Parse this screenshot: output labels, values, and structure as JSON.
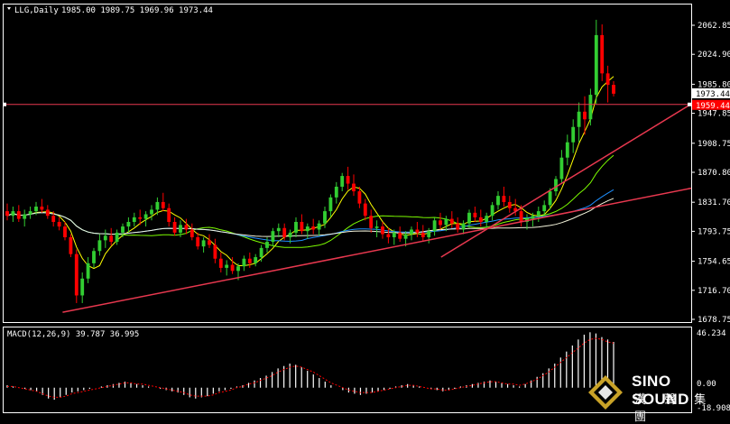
{
  "header": {
    "symbol": "LLG,Daily",
    "ohlc": "1985.00 1989.75 1969.96 1973.44",
    "triangle_color": "#ffffff"
  },
  "macd": {
    "label": "MACD(12,26,9) 39.787 36.995",
    "axis_top": "46.234",
    "axis_bottom": "-18.908",
    "axis_mid": "0.00"
  },
  "watermark": {
    "brand_en": "SINO SOUND",
    "brand_cn": "漢 聲 集 團"
  },
  "colors": {
    "background": "#000000",
    "bull_candle": "#32cd32",
    "bear_candle": "#ff0000",
    "channel_line": "#e8384f",
    "horizontal_line": "#e8384f",
    "ma_fast": "#ffff00",
    "ma_mid": "#1e90ff",
    "ma_slow1": "#7cfc00",
    "ma_slow2": "#f5f5dc",
    "macd_hist": "#ffffff",
    "macd_signal": "#ff0000",
    "price_badge": "#ffffff",
    "level_badge": "#ff0000"
  },
  "chart_data": {
    "type": "candlestick",
    "title": "LLG,Daily",
    "y_axis_ticks": [
      "2062.85",
      "2024.90",
      "1985.80",
      "1947.85",
      "1908.75",
      "1870.80",
      "1831.70",
      "1793.75",
      "1754.65",
      "1716.70",
      "1678.75"
    ],
    "price_badge": "1973.44",
    "level_badge": "1959.44",
    "ylim": [
      1678.75,
      2080
    ],
    "horizontal_level": 1959.44,
    "channel_upper": [
      [
        1,
        1760
      ],
      [
        97,
        1870
      ],
      [
        163,
        1960
      ]
    ],
    "channel_lower": [
      [
        1,
        1688
      ],
      [
        97,
        1760
      ],
      [
        163,
        1850
      ]
    ],
    "ohlc": [
      [
        1820,
        1830,
        1808,
        1814
      ],
      [
        1814,
        1826,
        1806,
        1820
      ],
      [
        1820,
        1828,
        1806,
        1810
      ],
      [
        1810,
        1822,
        1800,
        1816
      ],
      [
        1816,
        1826,
        1810,
        1820
      ],
      [
        1820,
        1832,
        1815,
        1826
      ],
      [
        1826,
        1836,
        1818,
        1822
      ],
      [
        1822,
        1828,
        1810,
        1814
      ],
      [
        1814,
        1820,
        1800,
        1806
      ],
      [
        1806,
        1812,
        1795,
        1800
      ],
      [
        1800,
        1806,
        1782,
        1786
      ],
      [
        1786,
        1790,
        1760,
        1764
      ],
      [
        1764,
        1770,
        1700,
        1710
      ],
      [
        1710,
        1740,
        1700,
        1732
      ],
      [
        1732,
        1760,
        1726,
        1752
      ],
      [
        1752,
        1772,
        1746,
        1768
      ],
      [
        1768,
        1790,
        1762,
        1782
      ],
      [
        1782,
        1796,
        1772,
        1788
      ],
      [
        1788,
        1798,
        1775,
        1780
      ],
      [
        1780,
        1796,
        1776,
        1792
      ],
      [
        1792,
        1804,
        1786,
        1800
      ],
      [
        1800,
        1812,
        1792,
        1806
      ],
      [
        1806,
        1818,
        1800,
        1812
      ],
      [
        1812,
        1822,
        1802,
        1810
      ],
      [
        1810,
        1820,
        1800,
        1816
      ],
      [
        1816,
        1828,
        1808,
        1822
      ],
      [
        1822,
        1838,
        1815,
        1832
      ],
      [
        1832,
        1844,
        1820,
        1824
      ],
      [
        1824,
        1830,
        1800,
        1806
      ],
      [
        1806,
        1812,
        1788,
        1792
      ],
      [
        1792,
        1808,
        1786,
        1802
      ],
      [
        1802,
        1810,
        1790,
        1796
      ],
      [
        1796,
        1804,
        1782,
        1786
      ],
      [
        1786,
        1792,
        1770,
        1774
      ],
      [
        1774,
        1786,
        1766,
        1782
      ],
      [
        1782,
        1790,
        1772,
        1776
      ],
      [
        1776,
        1784,
        1752,
        1758
      ],
      [
        1758,
        1766,
        1740,
        1746
      ],
      [
        1746,
        1756,
        1736,
        1750
      ],
      [
        1750,
        1760,
        1738,
        1742
      ],
      [
        1742,
        1752,
        1730,
        1748
      ],
      [
        1748,
        1762,
        1742,
        1758
      ],
      [
        1758,
        1766,
        1746,
        1752
      ],
      [
        1752,
        1764,
        1748,
        1760
      ],
      [
        1760,
        1776,
        1754,
        1772
      ],
      [
        1772,
        1786,
        1766,
        1780
      ],
      [
        1780,
        1798,
        1774,
        1794
      ],
      [
        1794,
        1804,
        1786,
        1798
      ],
      [
        1798,
        1804,
        1782,
        1786
      ],
      [
        1786,
        1796,
        1778,
        1792
      ],
      [
        1792,
        1812,
        1786,
        1806
      ],
      [
        1806,
        1816,
        1790,
        1794
      ],
      [
        1794,
        1804,
        1784,
        1800
      ],
      [
        1800,
        1810,
        1790,
        1796
      ],
      [
        1796,
        1808,
        1788,
        1804
      ],
      [
        1804,
        1826,
        1798,
        1820
      ],
      [
        1820,
        1842,
        1812,
        1838
      ],
      [
        1838,
        1858,
        1830,
        1852
      ],
      [
        1852,
        1870,
        1846,
        1866
      ],
      [
        1866,
        1878,
        1848,
        1856
      ],
      [
        1856,
        1868,
        1840,
        1846
      ],
      [
        1846,
        1852,
        1824,
        1830
      ],
      [
        1830,
        1836,
        1808,
        1814
      ],
      [
        1814,
        1822,
        1792,
        1798
      ],
      [
        1798,
        1808,
        1786,
        1800
      ],
      [
        1800,
        1806,
        1784,
        1790
      ],
      [
        1790,
        1798,
        1778,
        1786
      ],
      [
        1786,
        1796,
        1776,
        1792
      ],
      [
        1792,
        1800,
        1780,
        1784
      ],
      [
        1784,
        1794,
        1774,
        1790
      ],
      [
        1790,
        1800,
        1782,
        1796
      ],
      [
        1796,
        1806,
        1786,
        1792
      ],
      [
        1792,
        1802,
        1780,
        1786
      ],
      [
        1786,
        1798,
        1778,
        1794
      ],
      [
        1794,
        1812,
        1788,
        1808
      ],
      [
        1808,
        1818,
        1796,
        1802
      ],
      [
        1802,
        1814,
        1794,
        1810
      ],
      [
        1810,
        1820,
        1798,
        1804
      ],
      [
        1804,
        1812,
        1792,
        1796
      ],
      [
        1796,
        1808,
        1790,
        1804
      ],
      [
        1804,
        1822,
        1798,
        1818
      ],
      [
        1818,
        1826,
        1806,
        1812
      ],
      [
        1812,
        1822,
        1800,
        1806
      ],
      [
        1806,
        1818,
        1798,
        1814
      ],
      [
        1814,
        1832,
        1808,
        1828
      ],
      [
        1828,
        1846,
        1822,
        1840
      ],
      [
        1840,
        1852,
        1826,
        1832
      ],
      [
        1832,
        1840,
        1818,
        1824
      ],
      [
        1824,
        1836,
        1814,
        1820
      ],
      [
        1820,
        1828,
        1800,
        1806
      ],
      [
        1806,
        1816,
        1796,
        1810
      ],
      [
        1810,
        1818,
        1800,
        1814
      ],
      [
        1814,
        1826,
        1806,
        1820
      ],
      [
        1820,
        1834,
        1812,
        1828
      ],
      [
        1828,
        1850,
        1822,
        1846
      ],
      [
        1846,
        1866,
        1840,
        1862
      ],
      [
        1862,
        1900,
        1856,
        1890
      ],
      [
        1890,
        1920,
        1880,
        1910
      ],
      [
        1910,
        1940,
        1896,
        1930
      ],
      [
        1930,
        1962,
        1910,
        1950
      ],
      [
        1950,
        1970,
        1920,
        1940
      ],
      [
        1940,
        1980,
        1932,
        1972
      ],
      [
        1972,
        2070,
        1960,
        2050
      ],
      [
        2050,
        2064,
        1990,
        2000
      ],
      [
        2000,
        2010,
        1962,
        1985
      ],
      [
        1985,
        1989.75,
        1969.96,
        1973.44
      ]
    ],
    "macd_hist": [
      2,
      1,
      0,
      -1,
      -2,
      -3,
      -6,
      -9,
      -10,
      -8,
      -6,
      -4,
      -3,
      -2,
      -1,
      0,
      1,
      2,
      3,
      4,
      5,
      4,
      3,
      2,
      1,
      0,
      -1,
      -2,
      -3,
      -4,
      -6,
      -8,
      -9,
      -8,
      -7,
      -5,
      -3,
      -2,
      -1,
      1,
      2,
      4,
      6,
      8,
      10,
      13,
      16,
      18,
      20,
      19,
      17,
      14,
      11,
      8,
      5,
      2,
      0,
      -2,
      -4,
      -5,
      -6,
      -5,
      -4,
      -3,
      -2,
      -1,
      1,
      2,
      3,
      2,
      1,
      0,
      -1,
      -2,
      -3,
      -2,
      -1,
      1,
      2,
      3,
      4,
      5,
      6,
      5,
      4,
      3,
      2,
      1,
      3,
      6,
      9,
      12,
      16,
      20,
      25,
      30,
      35,
      40,
      44,
      46,
      45,
      42,
      40,
      38
    ],
    "macd_signal": [
      1,
      1,
      0,
      -1,
      -2,
      -3,
      -5,
      -7,
      -8,
      -8,
      -7,
      -5,
      -4,
      -3,
      -2,
      -1,
      0,
      1,
      2,
      3,
      4,
      4,
      3,
      3,
      2,
      1,
      0,
      -1,
      -2,
      -3,
      -4,
      -6,
      -7,
      -7,
      -7,
      -6,
      -4,
      -3,
      -2,
      0,
      1,
      3,
      4,
      6,
      8,
      10,
      13,
      15,
      17,
      18,
      17,
      15,
      13,
      10,
      7,
      4,
      2,
      0,
      -2,
      -3,
      -4,
      -4,
      -4,
      -3,
      -2,
      -1,
      0,
      1,
      2,
      2,
      1,
      0,
      -1,
      -1,
      -2,
      -2,
      -1,
      0,
      1,
      2,
      3,
      4,
      5,
      5,
      4,
      3,
      3,
      2,
      3,
      5,
      7,
      10,
      13,
      17,
      21,
      25,
      29,
      33,
      37,
      40,
      41,
      40,
      38,
      37
    ]
  }
}
